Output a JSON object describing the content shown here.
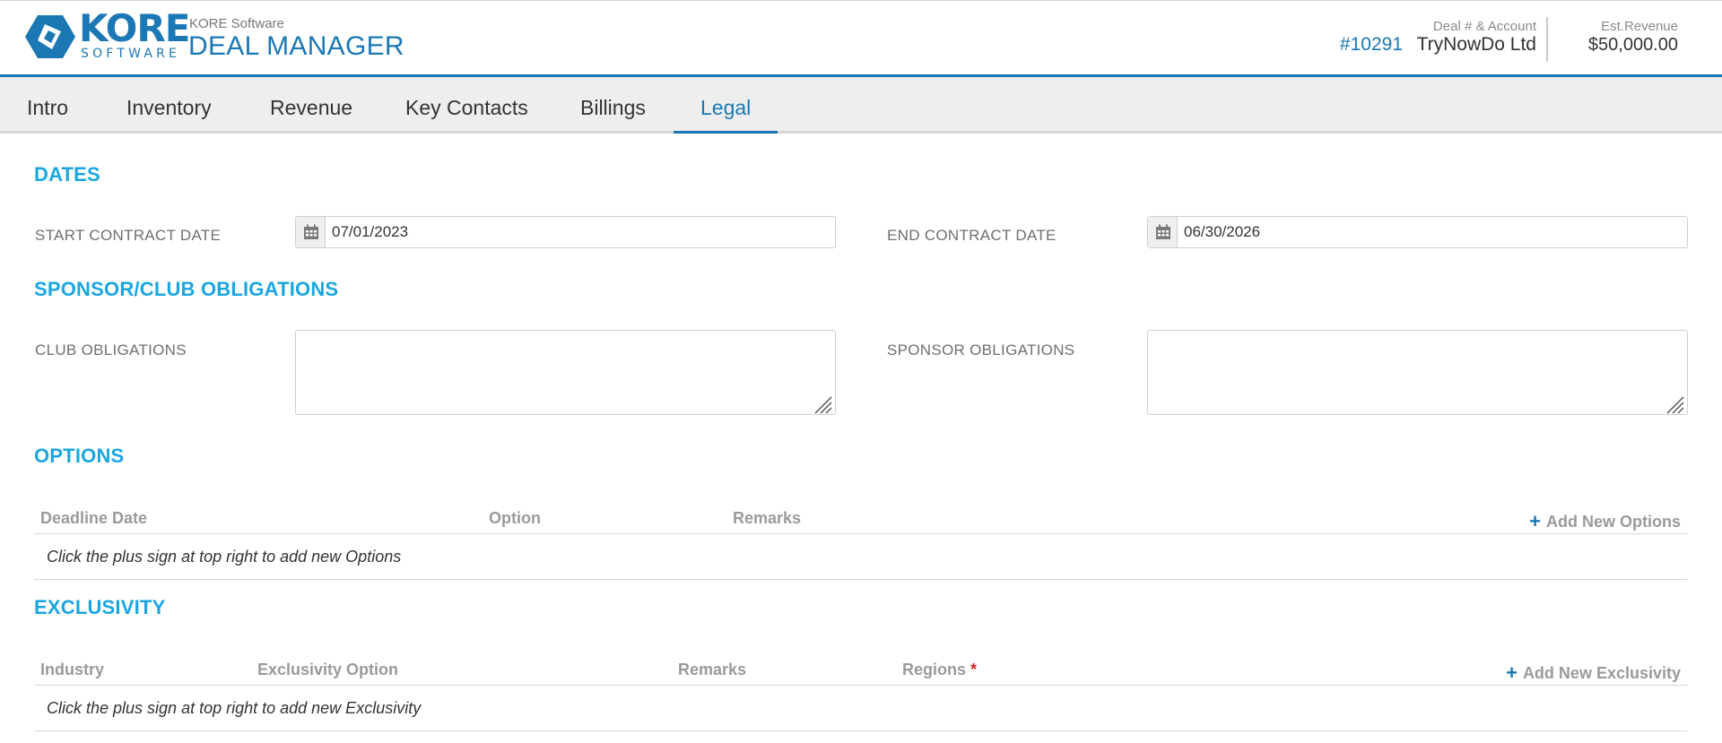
{
  "header": {
    "company": "KORE Software",
    "title": "DEAL MANAGER",
    "logo_word": "KORE",
    "logo_sub": "SOFTWARE",
    "deal_label": "Deal # & Account",
    "deal_number": "#10291",
    "account": "TryNowDo Ltd",
    "revenue_label": "Est.Revenue",
    "revenue_value": "$50,000.00"
  },
  "tabs": [
    {
      "label": "Intro",
      "active": false
    },
    {
      "label": "Inventory",
      "active": false
    },
    {
      "label": "Revenue",
      "active": false
    },
    {
      "label": "Key Contacts",
      "active": false
    },
    {
      "label": "Billings",
      "active": false
    },
    {
      "label": "Legal",
      "active": true
    }
  ],
  "dates": {
    "title": "DATES",
    "start_label": "START CONTRACT DATE",
    "start_value": "07/01/2023",
    "end_label": "END CONTRACT DATE",
    "end_value": "06/30/2026"
  },
  "obligations": {
    "title": "SPONSOR/CLUB OBLIGATIONS",
    "club_label": "CLUB OBLIGATIONS",
    "club_value": "",
    "sponsor_label": "SPONSOR OBLIGATIONS",
    "sponsor_value": ""
  },
  "options": {
    "title": "OPTIONS",
    "columns": [
      "Deadline Date",
      "Option",
      "Remarks"
    ],
    "add_label": "Add New Options",
    "empty_text": "Click the plus sign at top right to add new Options"
  },
  "exclusivity": {
    "title": "EXCLUSIVITY",
    "columns": [
      "Industry",
      "Exclusivity Option",
      "Remarks",
      "Regions"
    ],
    "required_mark": "*",
    "add_label": "Add New Exclusivity",
    "empty_text": "Click the plus sign at top right to add new Exclusivity"
  },
  "colors": {
    "brand_blue": "#1b78b4",
    "section_blue": "#1ba6e0",
    "required_red": "#e02020"
  }
}
